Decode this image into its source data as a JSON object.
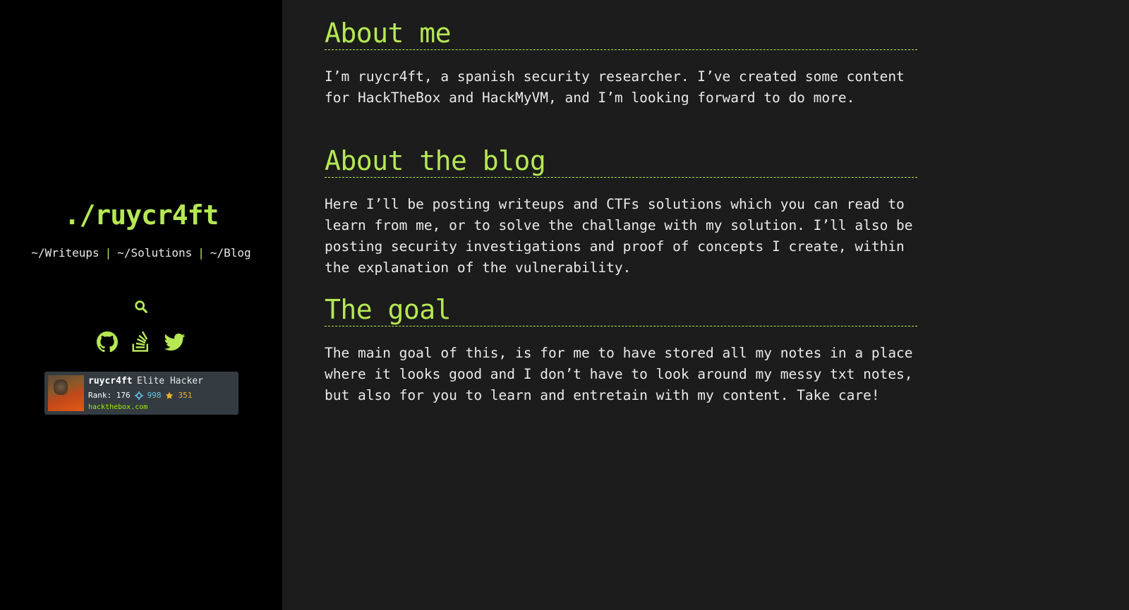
{
  "sidebar": {
    "site_title": "./ruycr4ft",
    "nav": [
      {
        "label": "~/Writeups"
      },
      {
        "label": "~/Solutions"
      },
      {
        "label": "~/Blog"
      }
    ],
    "nav_separator": "|",
    "search_icon": "search-icon",
    "socials": [
      {
        "icon": "github-icon"
      },
      {
        "icon": "stackoverflow-icon"
      },
      {
        "icon": "twitter-icon"
      }
    ]
  },
  "htb_badge": {
    "username": "ruycr4ft",
    "title": "Elite Hacker",
    "rank_label": "Rank: 176",
    "respect": "998",
    "points": "351",
    "site": "hackthebox.com"
  },
  "sections": [
    {
      "heading": "About me",
      "body": "I’m ruycr4ft, a spanish security researcher. I’ve created some content for HackTheBox and HackMyVM, and I’m looking forward to do more."
    },
    {
      "heading": "About the blog",
      "body": "Here I’ll be posting writeups and CTFs solutions which you can read to learn from me, or to solve the challange with my solution. I’ll also be posting security investigations and proof of concepts I create, within the explanation of the vulnerability."
    },
    {
      "heading": "The goal",
      "body": "The main goal of this, is for me to have stored all my notes in a place where it looks good and I don’t have to look around my messy txt notes, but also for you to learn and entretain with my content. Take care!"
    }
  ],
  "colors": {
    "accent": "#b5e853",
    "sidebar_bg": "#000000",
    "main_bg": "#1c1c1c",
    "badge_bg": "#343c42"
  }
}
